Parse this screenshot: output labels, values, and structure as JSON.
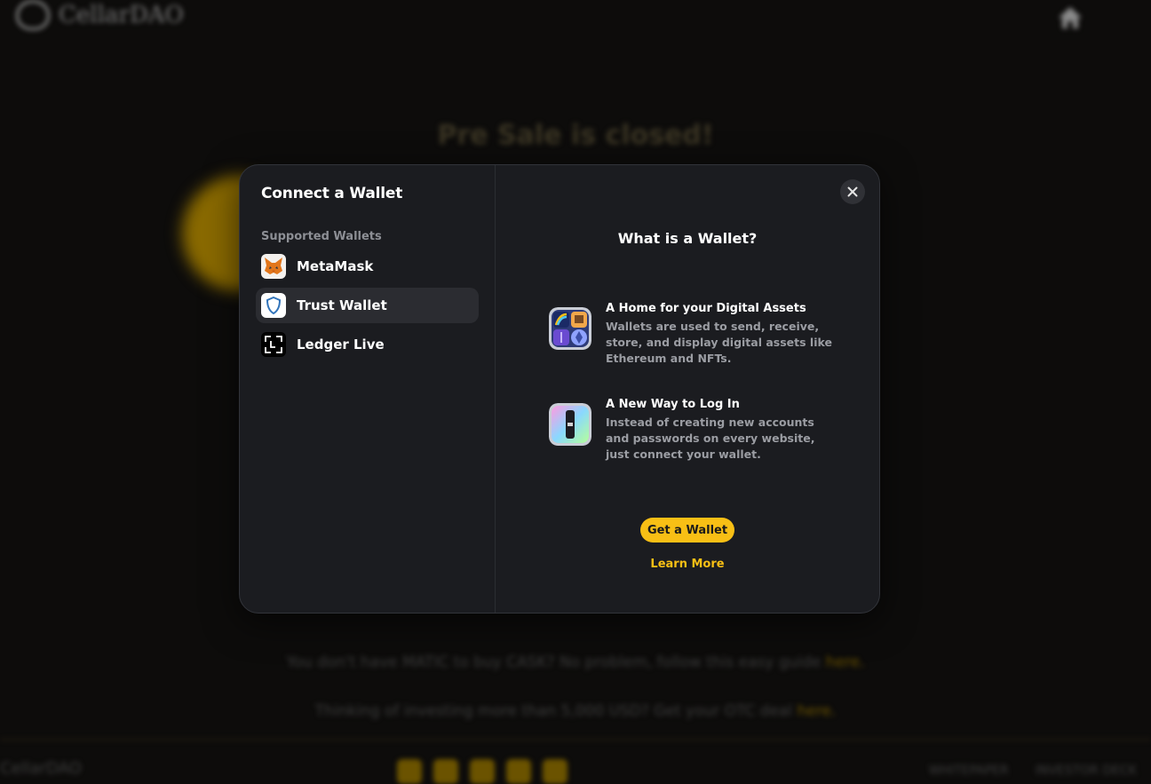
{
  "background": {
    "brand": "CellarDAO",
    "headline": "Pre Sale is closed!",
    "line1_text": "You don't have MATIC to buy CASK? No problem, follow this easy guide ",
    "line1_link": "here.",
    "line2_text": "Thinking of investing more than 5,000 USD? Get your OTC deal ",
    "line2_link": "here.",
    "footer_brand": "CellarDAO",
    "footer_links": [
      "WHITEPAPER",
      "INVESTOR DECK"
    ]
  },
  "modal": {
    "title": "Connect a Wallet",
    "section_label": "Supported Wallets",
    "wallets": [
      {
        "name": "MetaMask",
        "icon": "metamask-fox-icon",
        "selected": false
      },
      {
        "name": "Trust Wallet",
        "icon": "trust-wallet-shield-icon",
        "selected": true
      },
      {
        "name": "Ledger Live",
        "icon": "ledger-icon",
        "selected": false
      }
    ],
    "close_icon": "close-icon",
    "info_title": "What is a Wallet?",
    "features": [
      {
        "title": "A Home for your Digital Assets",
        "description": "Wallets are used to send, receive, store, and display digital assets like Ethereum and NFTs.",
        "icon": "digital-assets-icon"
      },
      {
        "title": "A New Way to Log In",
        "description": "Instead of creating new accounts and passwords on every website, just connect your wallet.",
        "icon": "login-key-icon"
      }
    ],
    "primary_button": "Get a Wallet",
    "secondary_link": "Learn More"
  },
  "colors": {
    "accent": "#f8bf15",
    "modal_bg": "#1b1c20",
    "selected_bg": "#2b2c31",
    "muted_text": "#9b9da3"
  }
}
